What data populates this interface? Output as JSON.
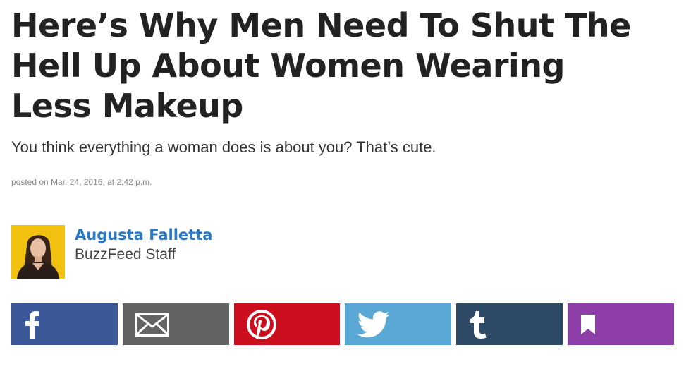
{
  "article": {
    "headline": "Here’s Why Men Need To Shut The Hell Up About Women Wearing Less Makeup",
    "dek": "You think everything a woman does is about you? That’s cute.",
    "posted": "posted on Mar. 24, 2016, at 2:42 p.m."
  },
  "author": {
    "name": "Augusta Falletta",
    "role": "BuzzFeed Staff"
  },
  "share": {
    "buttons": [
      {
        "name": "facebook",
        "icon": "facebook-icon",
        "color": "#3b5998"
      },
      {
        "name": "email",
        "icon": "envelope-icon",
        "color": "#636363"
      },
      {
        "name": "pinterest",
        "icon": "pinterest-icon",
        "color": "#cc0f1e"
      },
      {
        "name": "twitter",
        "icon": "twitter-bird-icon",
        "color": "#5aa8d6"
      },
      {
        "name": "tumblr",
        "icon": "tumblr-icon",
        "color": "#2f4a67"
      },
      {
        "name": "save",
        "icon": "bookmark-icon",
        "color": "#8e3fa9"
      }
    ]
  }
}
